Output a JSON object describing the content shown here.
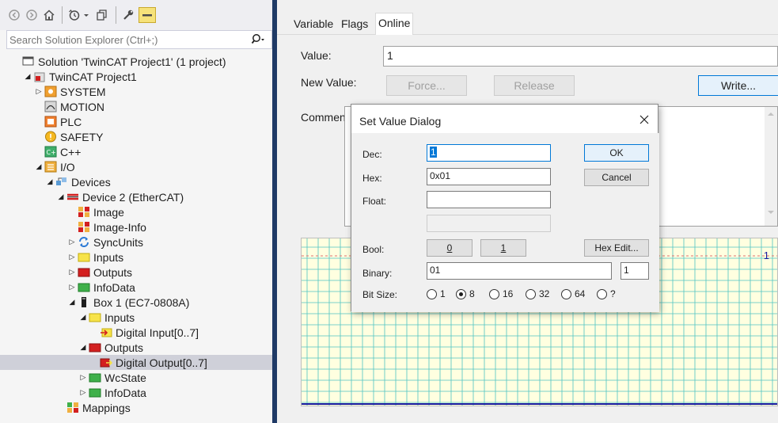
{
  "explorer": {
    "search_placeholder": "Search Solution Explorer (Ctrl+;)",
    "tree": [
      {
        "label": "Solution 'TwinCAT Project1' (1 project)",
        "icon": "solution-icon",
        "expander": ""
      },
      {
        "label": "TwinCAT Project1",
        "icon": "twincat-project-icon",
        "expander": "open"
      },
      {
        "label": "SYSTEM",
        "icon": "system-icon",
        "expander": "closed"
      },
      {
        "label": "MOTION",
        "icon": "motion-icon",
        "expander": ""
      },
      {
        "label": "PLC",
        "icon": "plc-icon",
        "expander": ""
      },
      {
        "label": "SAFETY",
        "icon": "safety-icon",
        "expander": ""
      },
      {
        "label": "C++",
        "icon": "cpp-icon",
        "expander": ""
      },
      {
        "label": "I/O",
        "icon": "io-icon",
        "expander": "open"
      },
      {
        "label": "Devices",
        "icon": "devices-icon",
        "expander": "open"
      },
      {
        "label": "Device 2 (EtherCAT)",
        "icon": "ethercat-device-icon",
        "expander": "open"
      },
      {
        "label": "Image",
        "icon": "image-icon",
        "expander": ""
      },
      {
        "label": "Image-Info",
        "icon": "image-info-icon",
        "expander": ""
      },
      {
        "label": "SyncUnits",
        "icon": "sync-units-icon",
        "expander": "closed"
      },
      {
        "label": "Inputs",
        "icon": "inputs-icon",
        "expander": "closed"
      },
      {
        "label": "Outputs",
        "icon": "outputs-icon",
        "expander": "closed"
      },
      {
        "label": "InfoData",
        "icon": "infodata-icon",
        "expander": "closed"
      },
      {
        "label": "Box 1 (EC7-0808A)",
        "icon": "box-icon",
        "expander": "open"
      },
      {
        "label": "Inputs",
        "icon": "inputs-icon",
        "expander": "open"
      },
      {
        "label": "Digital Input[0..7]",
        "icon": "digital-input-icon",
        "expander": ""
      },
      {
        "label": "Outputs",
        "icon": "outputs-icon",
        "expander": "open"
      },
      {
        "label": "Digital Output[0..7]",
        "icon": "digital-output-icon",
        "expander": "",
        "selected": true
      },
      {
        "label": "WcState",
        "icon": "wcstate-icon",
        "expander": "closed"
      },
      {
        "label": "InfoData",
        "icon": "infodata-icon",
        "expander": "closed"
      },
      {
        "label": "Mappings",
        "icon": "mappings-icon",
        "expander": ""
      }
    ]
  },
  "tabs": [
    "Variable",
    "Flags",
    "Online"
  ],
  "online": {
    "value_label": "Value:",
    "value": "1",
    "new_value_label": "New Value:",
    "force_label": "Force...",
    "release_label": "Release",
    "write_label": "Write...",
    "comment_label": "Comment:",
    "chart_value": "1"
  },
  "dialog": {
    "title": "Set Value Dialog",
    "dec_label": "Dec:",
    "dec_value": "1",
    "hex_label": "Hex:",
    "hex_value": "0x01",
    "float_label": "Float:",
    "float_value": "",
    "ok_label": "OK",
    "cancel_label": "Cancel",
    "bool_label": "Bool:",
    "bool_0": "0",
    "bool_1": "1",
    "hex_edit_label": "Hex Edit...",
    "binary_label": "Binary:",
    "binary_value": "01",
    "binary_count": "1",
    "bitsize_label": "Bit Size:",
    "bitsize_options": [
      "1",
      "8",
      "16",
      "32",
      "64",
      "?"
    ],
    "bitsize_selected": "8"
  },
  "colors": {
    "selection": "#cfd0d9",
    "divider": "#1f3a66",
    "chart_bg": "#ffffe0",
    "chart_grid": "#4fc3c3",
    "chart_line": "#1a1aa0",
    "accent": "#0078d7"
  }
}
